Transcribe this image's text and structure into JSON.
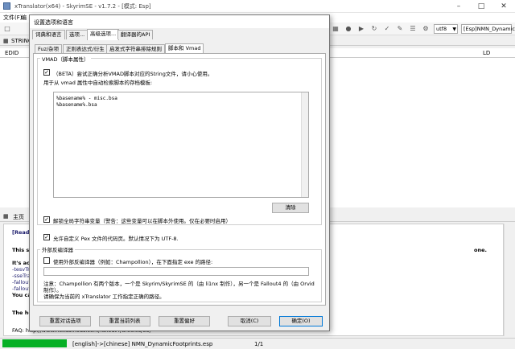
{
  "window": {
    "title": "xTranslator(x64) - SkyrimSE - v1.7.2 - [模式: Esp]",
    "menu": [
      "文件(F)",
      "编"
    ],
    "encoding": "utf8",
    "file_combo": "[Esp]NMN_Dynamic",
    "strings_tab": "STRING",
    "col_edid": "EDID",
    "col_ld": "LD",
    "bottom_tab": "主页"
  },
  "info": {
    "lines": [
      "[ReadM",
      "This s",
      "It's act",
      "-tesvTr",
      "-sseTra",
      "-fallout",
      "-fallout",
      "You ca",
      "The ho",
      "FAQ: http://www.nexusmods.com/fallout4/articles/35/"
    ],
    "right_tail": "one."
  },
  "status": {
    "lang": "[english]->[chinese] NMN_DynamicFootprints.esp",
    "page": "1/1"
  },
  "dialog": {
    "title": "设置选项和语言",
    "tabs": [
      "词典和语言",
      "选项...",
      "高级选项...",
      "翻译器的API"
    ],
    "subtabs": [
      "Fuz/杂项",
      "正则表达式/衍生",
      "启发式字符串排除规则",
      "脚本和 Vmad"
    ],
    "vmad_group": "VMAD（脚本属性）",
    "vmad_check": "（BETA）尝试正确分析VMAD脚本对应的String文件，请小心使用。",
    "vmad_desc": "用于从 vmad 属性中自动检索脚本的存档模板:",
    "memo_lines": [
      "%basename% - misc.bsa",
      "%basename%.bsa"
    ],
    "clear_button": "清除",
    "global_check": "解锁全局字符串变量（警告：这些变量可以在脚本外使用。仅在必要时启用）",
    "pex_check": "允许自定义 Pex 文件的代码页。默认情况下为 UTF-8.",
    "decompiler_group": "外部反编译器",
    "decompiler_check": "使用外部反编译器（例如：Champollion），在下面指定 exe 的路径:",
    "note_lines": [
      "注意：Champollion 有两个版本，一个是 Skyrim/SkyrimSE 的（由 li1nx 制作），另一个是 Fallout4 的（由 Orvid",
      "制作）。",
      "请确保为当前的 xTranslator 工作指定正确的路径。"
    ],
    "buttons": {
      "reset_dialog": "重置对话选项",
      "reset_list": "重置当前列表",
      "reset_pref": "重置偏好",
      "cancel": "取消(C)",
      "ok": "确定(O)"
    }
  }
}
